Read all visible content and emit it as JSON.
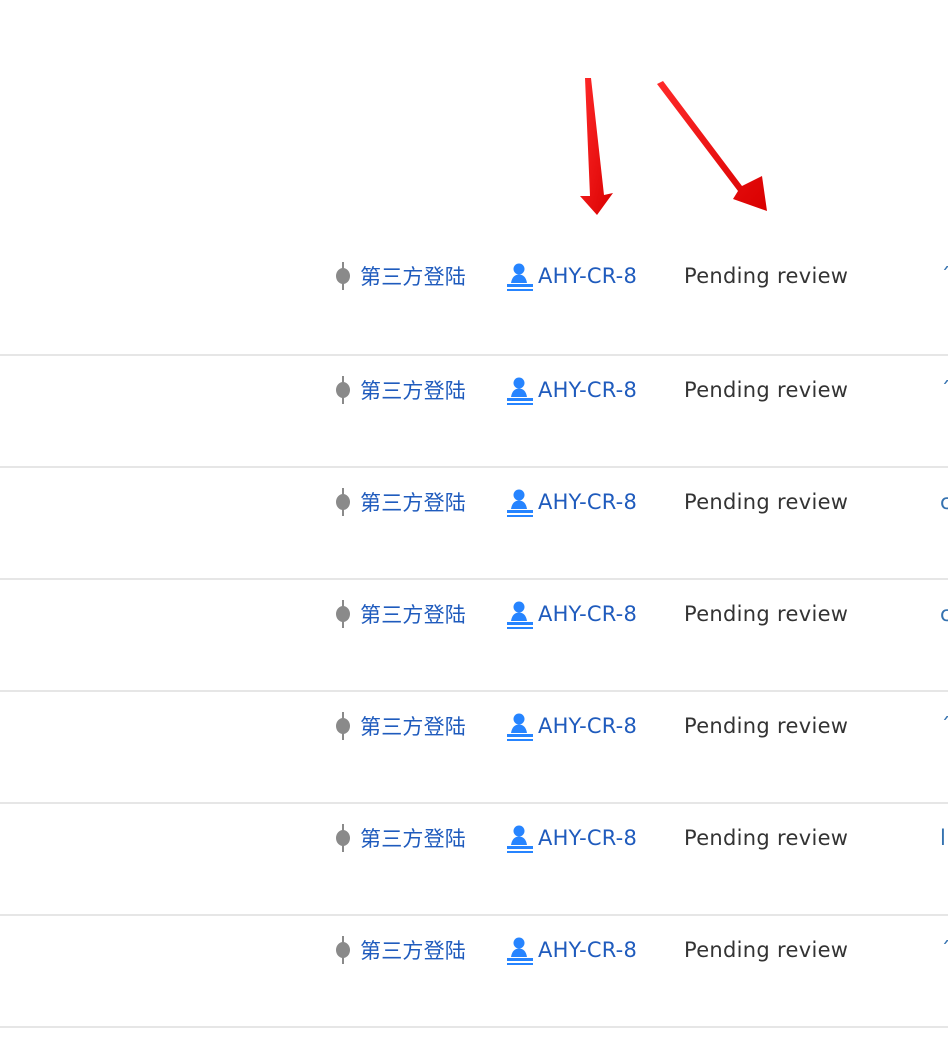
{
  "rows": [
    {
      "branch": "第三方登陆",
      "review_id": "AHY-CR-8",
      "status": "Pending review",
      "extra": "´"
    },
    {
      "branch": "第三方登陆",
      "review_id": "AHY-CR-8",
      "status": "Pending review",
      "extra": "´"
    },
    {
      "branch": "第三方登陆",
      "review_id": "AHY-CR-8",
      "status": "Pending review",
      "extra": "c"
    },
    {
      "branch": "第三方登陆",
      "review_id": "AHY-CR-8",
      "status": "Pending review",
      "extra": "c"
    },
    {
      "branch": "第三方登陆",
      "review_id": "AHY-CR-8",
      "status": "Pending review",
      "extra": "´"
    },
    {
      "branch": "第三方登陆",
      "review_id": "AHY-CR-8",
      "status": "Pending review",
      "extra": "l"
    },
    {
      "branch": "第三方登陆",
      "review_id": "AHY-CR-8",
      "status": "Pending review",
      "extra": "´"
    }
  ],
  "icons": {
    "branch": "branch-icon",
    "review": "code-review-icon",
    "annotation": "red-arrow-icon"
  },
  "colors": {
    "link": "#1f5bbd",
    "status_text": "#333333",
    "review_icon": "#2684ff",
    "branch_icon": "#8a8a8a",
    "divider": "#e6e6e6",
    "annotation_arrow": "#ff0000"
  }
}
